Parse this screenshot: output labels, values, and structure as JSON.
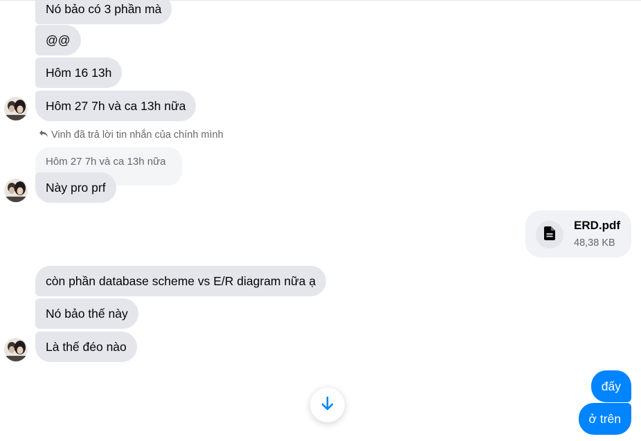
{
  "thread": {
    "group1": [
      "Nó bảo có 3 phần mà",
      "@@",
      "Hôm 16 13h",
      "Hôm 27 7h và ca 13h nữa"
    ],
    "reply": {
      "meta_text": "Vinh đã trả lời tin nhắn của chính mình",
      "quoted_text": "Hôm 27 7h và ca 13h nữa",
      "message": "Này pro prf"
    },
    "attachment": {
      "file_name": "ERD.pdf",
      "file_size": "48,38 KB",
      "icon": "document-icon"
    },
    "group2": [
      "còn phần database scheme vs E/R diagram nữa ạ",
      "Nó bảo thế này",
      "Là thế đéo nào"
    ],
    "outgoing": [
      "đấy",
      "ở trên"
    ]
  },
  "controls": {
    "scroll_icon": "arrow-down-icon"
  },
  "colors": {
    "incoming_bubble": "#e4e6eb",
    "outgoing_bubble": "#0084ff",
    "accent": "#0084ff",
    "muted_text": "#65676b"
  }
}
